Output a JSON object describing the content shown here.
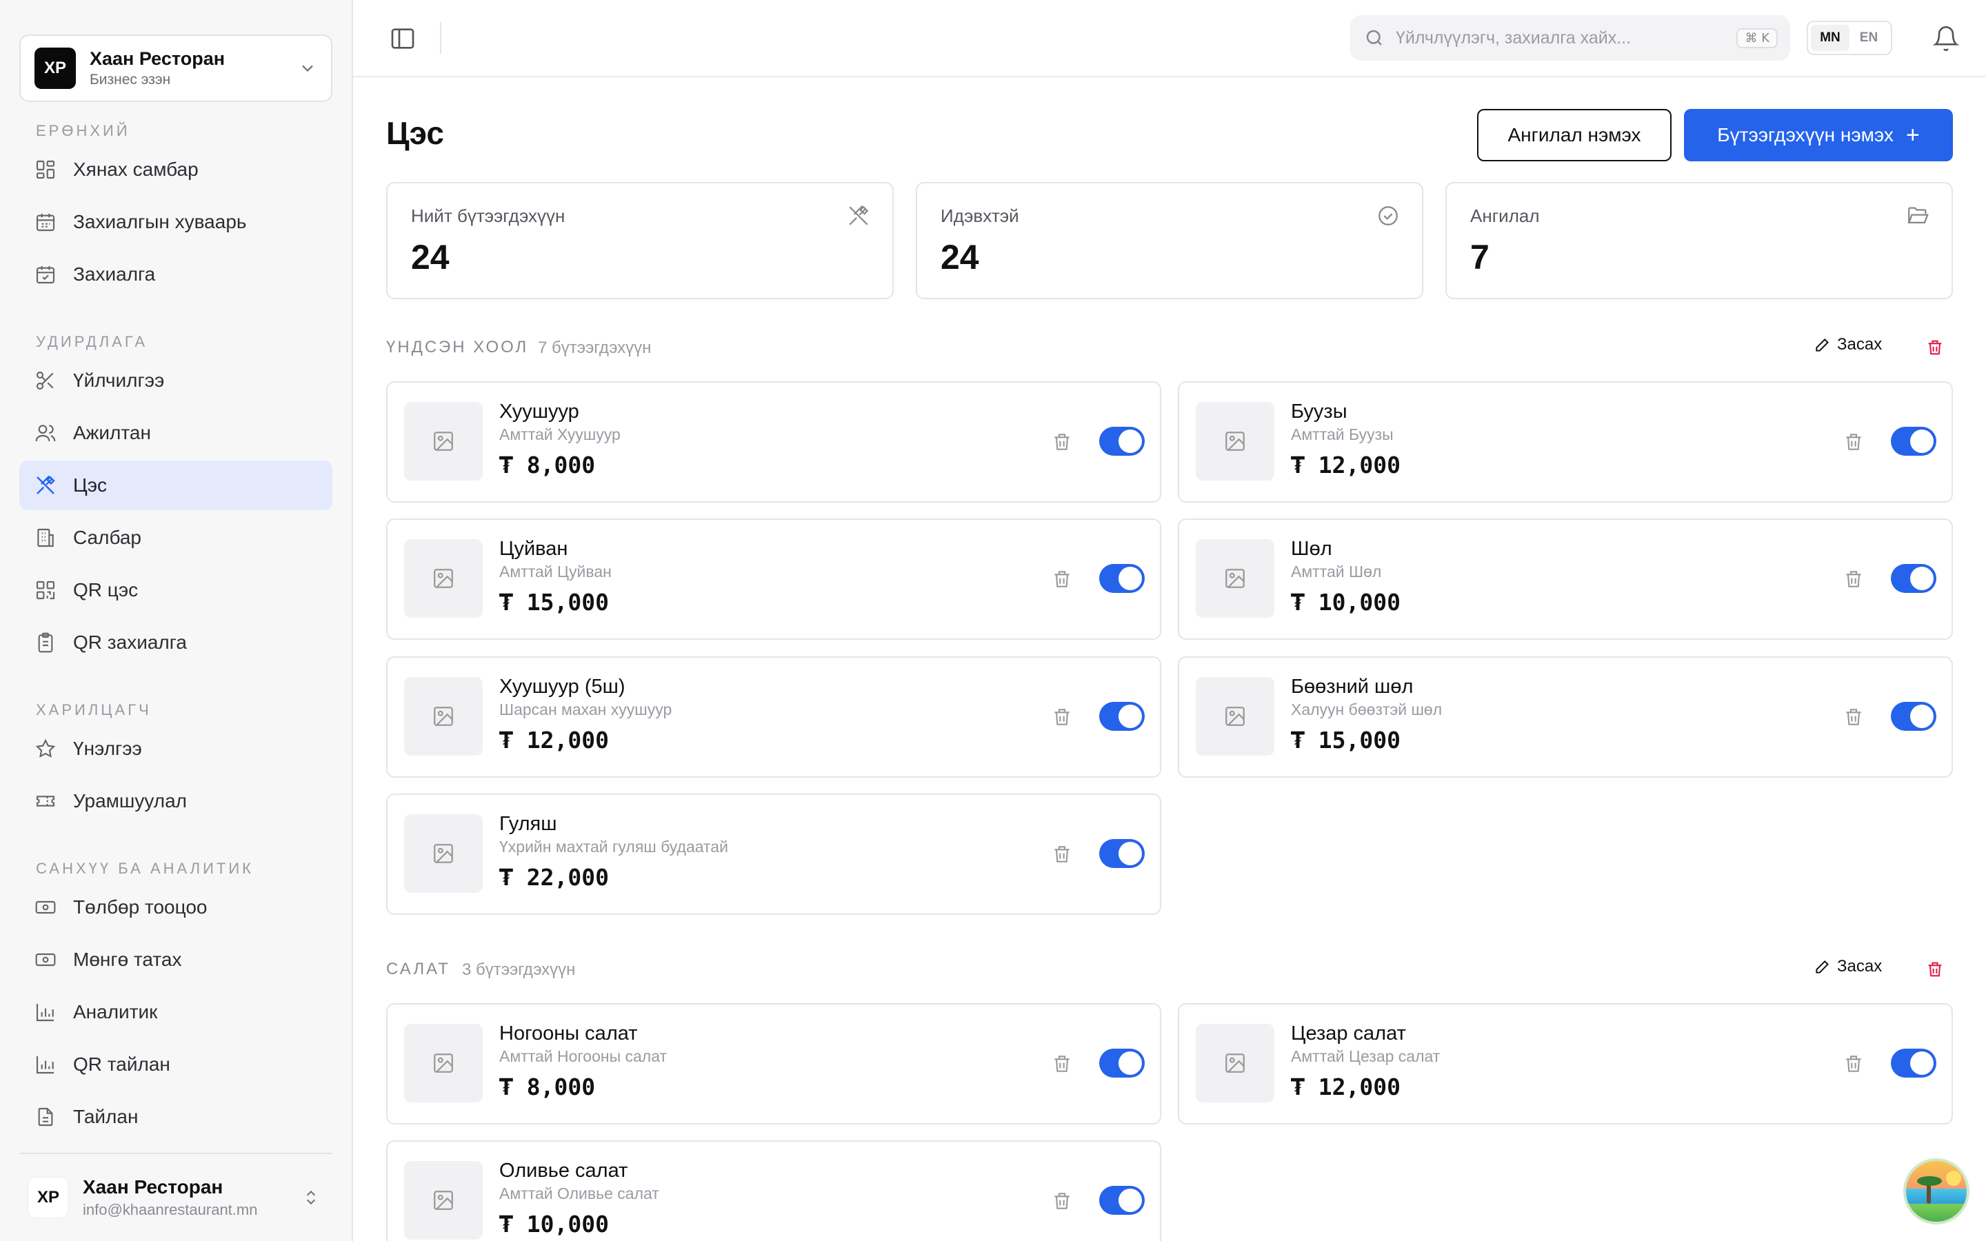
{
  "business": {
    "initials": "ХР",
    "name": "Хаан Ресторан",
    "role": "Бизнес эзэн"
  },
  "nav": {
    "sections": [
      {
        "title": "Ерөнхий",
        "items": [
          "Хянах самбар",
          "Захиалгын хуваарь",
          "Захиалга"
        ]
      },
      {
        "title": "Удирдлага",
        "items": [
          "Үйлчилгээ",
          "Ажилтан",
          "Цэс",
          "Салбар",
          "QR цэс",
          "QR захиалга"
        ]
      },
      {
        "title": "Харилцагч",
        "items": [
          "Үнэлгээ",
          "Урамшуулал"
        ]
      },
      {
        "title": "Санхүү ба аналитик",
        "items": [
          "Төлбөр тооцоо",
          "Мөнгө татах",
          "Аналитик",
          "QR тайлан",
          "Тайлан"
        ]
      }
    ],
    "active": "Цэс"
  },
  "user": {
    "initials": "ХР",
    "name": "Хаан Ресторан",
    "email": "info@khaanrestaurant.mn"
  },
  "topbar": {
    "search_placeholder": "Үйлчлүүлэгч, захиалга хайх...",
    "shortcut": "⌘ K",
    "lang_mn": "MN",
    "lang_en": "EN",
    "active_lang": "MN"
  },
  "page": {
    "title": "Цэс",
    "add_category": "Ангилал нэмэх",
    "add_product": "Бүтээгдэхүүн нэмэх"
  },
  "stats": [
    {
      "label": "Нийт бүтээгдэхүүн",
      "value": "24",
      "icon": "utensils-crossed-icon"
    },
    {
      "label": "Идэвхтэй",
      "value": "24",
      "icon": "check-circle-icon"
    },
    {
      "label": "Ангилал",
      "value": "7",
      "icon": "folder-open-icon"
    }
  ],
  "edit_label": "Засах",
  "categories": [
    {
      "name": "Үндсэн хоол",
      "count": "7 бүтээгдэхүүн",
      "items": [
        {
          "name": "Хуушуур",
          "desc": "Амттай Хуушуур",
          "price": "₮ 8,000",
          "active": true
        },
        {
          "name": "Буузы",
          "desc": "Амттай Буузы",
          "price": "₮ 12,000",
          "active": true
        },
        {
          "name": "Цуйван",
          "desc": "Амттай Цуйван",
          "price": "₮ 15,000",
          "active": true
        },
        {
          "name": "Шөл",
          "desc": "Амттай Шөл",
          "price": "₮ 10,000",
          "active": true
        },
        {
          "name": "Хуушуур (5ш)",
          "desc": "Шарсан махан хуушуур",
          "price": "₮ 12,000",
          "active": true
        },
        {
          "name": "Бөөзний шөл",
          "desc": "Халуун бөөзтэй шөл",
          "price": "₮ 15,000",
          "active": true
        },
        {
          "name": "Гуляш",
          "desc": "Үхрийн махтай гуляш будаатай",
          "price": "₮ 22,000",
          "active": true
        }
      ]
    },
    {
      "name": "Салат",
      "count": "3 бүтээгдэхүүн",
      "items": [
        {
          "name": "Ногооны салат",
          "desc": "Амттай Ногооны салат",
          "price": "₮ 8,000",
          "active": true
        },
        {
          "name": "Цезар салат",
          "desc": "Амттай Цезар салат",
          "price": "₮ 12,000",
          "active": true
        },
        {
          "name": "Оливье салат",
          "desc": "Амттай Оливье салат",
          "price": "₮ 10,000",
          "active": true
        }
      ]
    }
  ],
  "colors": {
    "accent": "#2563eb",
    "active_nav_bg": "#e4eafb",
    "danger": "#e11d48"
  }
}
